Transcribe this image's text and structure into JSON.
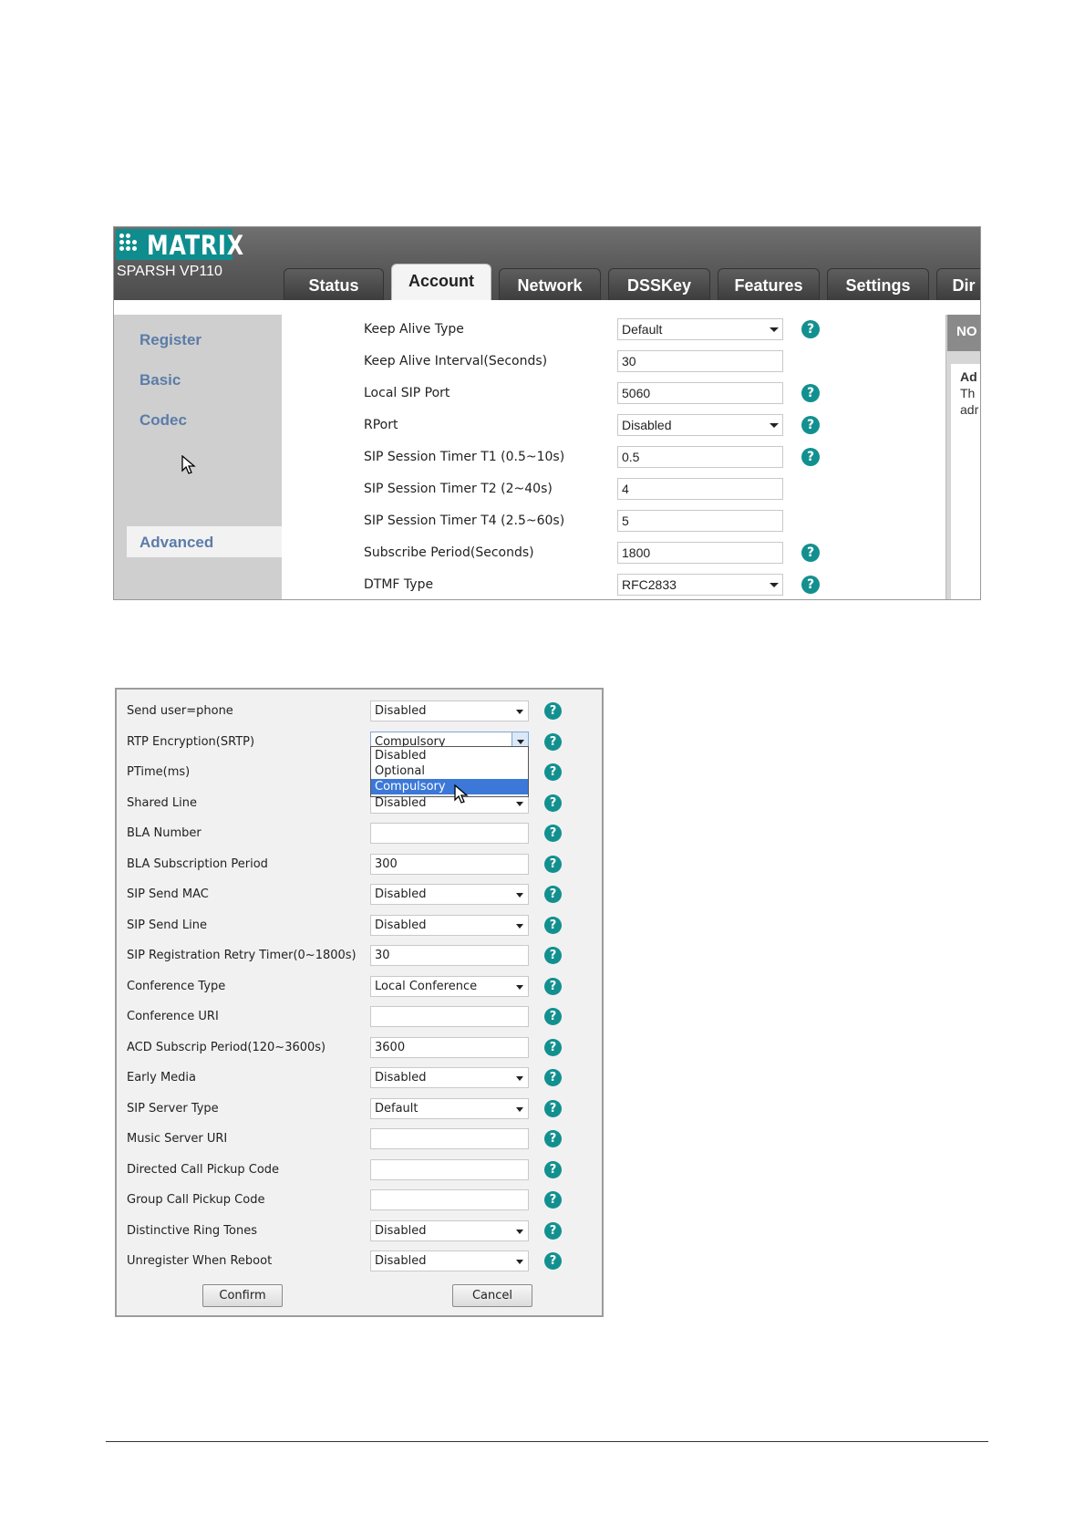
{
  "header": {
    "logo_text": "MATRIX",
    "model": "SPARSH VP110",
    "tabs": [
      "Status",
      "Account",
      "Network",
      "DSSKey",
      "Features",
      "Settings",
      "Dir"
    ],
    "active_tab": "Account"
  },
  "sidebar": {
    "items": [
      "Register",
      "Basic",
      "Codec",
      "Advanced"
    ],
    "active": "Advanced"
  },
  "advanced_top": {
    "rows": [
      {
        "label": "Keep Alive Type",
        "value": "Default",
        "kind": "select",
        "help": true
      },
      {
        "label": "Keep Alive Interval(Seconds)",
        "value": "30",
        "kind": "text",
        "help": false
      },
      {
        "label": "Local SIP Port",
        "value": "5060",
        "kind": "text",
        "help": true
      },
      {
        "label": "RPort",
        "value": "Disabled",
        "kind": "select",
        "help": true
      },
      {
        "label": "SIP Session Timer T1 (0.5~10s)",
        "value": "0.5",
        "kind": "text",
        "help": true
      },
      {
        "label": "SIP Session Timer T2 (2~40s)",
        "value": "4",
        "kind": "text",
        "help": false
      },
      {
        "label": "SIP Session Timer T4 (2.5~60s)",
        "value": "5",
        "kind": "text",
        "help": false
      },
      {
        "label": "Subscribe Period(Seconds)",
        "value": "1800",
        "kind": "text",
        "help": true
      },
      {
        "label": "DTMF Type",
        "value": "RFC2833",
        "kind": "select",
        "help": true
      }
    ],
    "right_panel": {
      "heading": "NO",
      "line1": "Ad",
      "line2": "Th",
      "line3": "adr"
    }
  },
  "advanced_bottom": {
    "rows": [
      {
        "label": "Send user=phone",
        "value": "Disabled",
        "kind": "select"
      },
      {
        "label": "RTP Encryption(SRTP)",
        "value": "Compulsory",
        "kind": "select-open"
      },
      {
        "label": "PTime(ms)",
        "value": "",
        "kind": "select"
      },
      {
        "label": "Shared Line",
        "value": "Disabled",
        "kind": "select"
      },
      {
        "label": "BLA Number",
        "value": "",
        "kind": "text"
      },
      {
        "label": "BLA Subscription Period",
        "value": "300",
        "kind": "text"
      },
      {
        "label": "SIP Send MAC",
        "value": "Disabled",
        "kind": "select"
      },
      {
        "label": "SIP Send Line",
        "value": "Disabled",
        "kind": "select"
      },
      {
        "label": "SIP Registration Retry Timer(0~1800s)",
        "value": "30",
        "kind": "text"
      },
      {
        "label": "Conference Type",
        "value": "Local Conference",
        "kind": "select"
      },
      {
        "label": "Conference URI",
        "value": "",
        "kind": "text"
      },
      {
        "label": "ACD Subscrip Period(120~3600s)",
        "value": "3600",
        "kind": "text"
      },
      {
        "label": "Early Media",
        "value": "Disabled",
        "kind": "select"
      },
      {
        "label": "SIP Server Type",
        "value": "Default",
        "kind": "select"
      },
      {
        "label": "Music Server URI",
        "value": "",
        "kind": "text"
      },
      {
        "label": "Directed Call Pickup Code",
        "value": "",
        "kind": "text"
      },
      {
        "label": "Group Call Pickup Code",
        "value": "",
        "kind": "text"
      },
      {
        "label": "Distinctive Ring Tones",
        "value": "Disabled",
        "kind": "select"
      },
      {
        "label": "Unregister When Reboot",
        "value": "Disabled",
        "kind": "select"
      }
    ],
    "srtp_options": [
      "Disabled",
      "Optional",
      "Compulsory"
    ],
    "srtp_highlighted": "Compulsory",
    "confirm_label": "Confirm",
    "cancel_label": "Cancel"
  },
  "colors": {
    "accent_teal": "#12908f",
    "sidebar_link": "#5b7ca8",
    "selection_blue": "#3b78d8"
  }
}
